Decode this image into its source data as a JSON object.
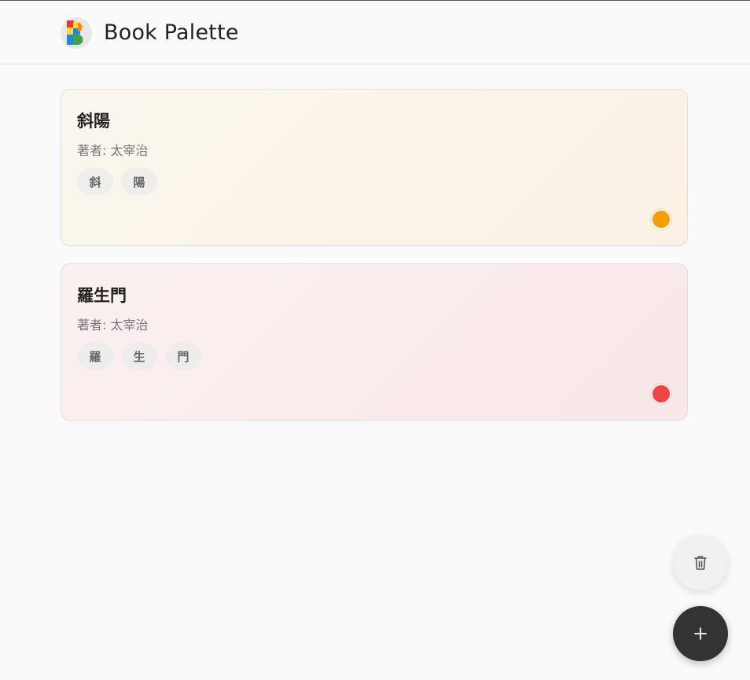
{
  "app": {
    "title": "Book Palette",
    "logo_icon": "book-palette-logo-icon"
  },
  "books": [
    {
      "title": "斜陽",
      "author": "著者: 太宰治",
      "chars": [
        "斜",
        "陽"
      ],
      "color": "#f59e0b",
      "gradient": [
        "#fbf7ee",
        "#faf1e4"
      ]
    },
    {
      "title": "羅生門",
      "author": "著者: 太宰治",
      "chars": [
        "羅",
        "生",
        "門"
      ],
      "color": "#ef4444",
      "gradient": [
        "#faf0f0",
        "#f8e8e8"
      ]
    }
  ],
  "actions": {
    "delete_icon": "trash-icon",
    "add_label": "+",
    "add_icon": "plus-icon"
  }
}
